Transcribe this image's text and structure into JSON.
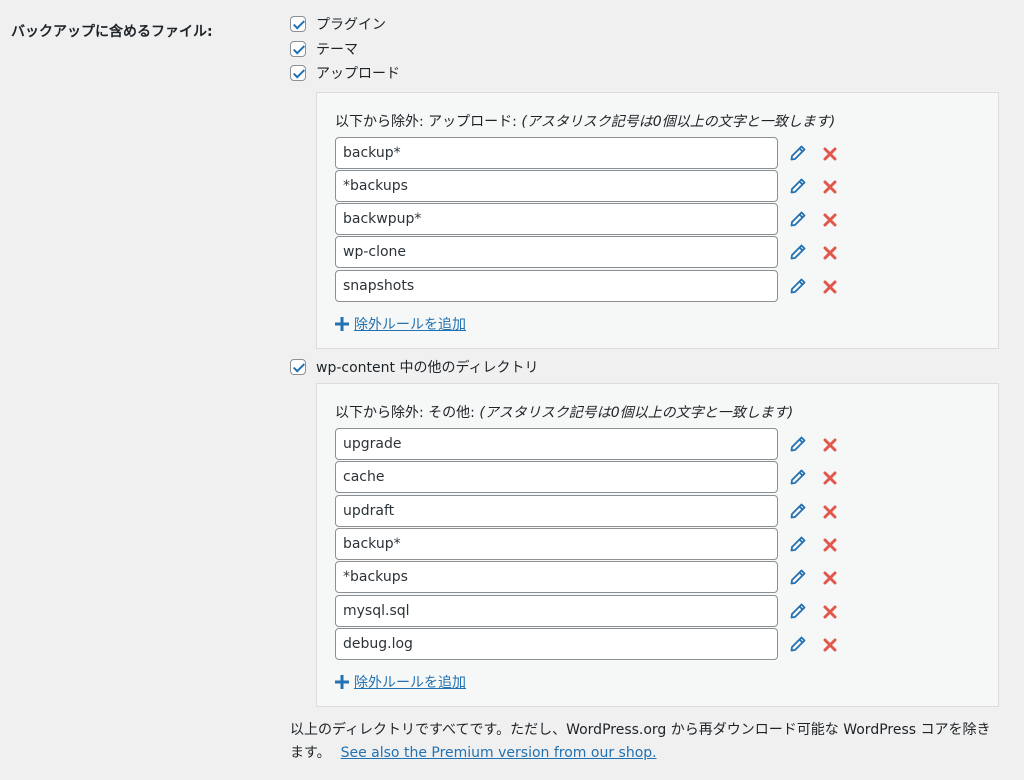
{
  "label": "バックアップに含めるファイル:",
  "checks": {
    "plugins": "プラグイン",
    "themes": "テーマ",
    "uploads": "アップロード",
    "others": "wp-content 中の他のディレクトリ"
  },
  "uploads_exclude": {
    "heading": "以下から除外: アップロード:",
    "hint": "(アスタリスク記号は0個以上の文字と一致します)",
    "rules": [
      "backup*",
      "*backups",
      "backwpup*",
      "wp-clone",
      "snapshots"
    ],
    "add_label": "除外ルールを追加"
  },
  "others_exclude": {
    "heading": "以下から除外: その他:",
    "hint": "(アスタリスク記号は0個以上の文字と一致します)",
    "rules": [
      "upgrade",
      "cache",
      "updraft",
      "backup*",
      "*backups",
      "mysql.sql",
      "debug.log"
    ],
    "add_label": "除外ルールを追加"
  },
  "footnote": {
    "text": "以上のディレクトリですべてです。ただし、WordPress.org から再ダウンロード可能な WordPress コアを除きます。",
    "link": "See also the Premium version from our shop."
  },
  "colors": {
    "link": "#2271b1",
    "delete": "#e2574c",
    "edit": "#2271b1"
  },
  "icons": {
    "edit": "pencil-icon",
    "delete": "close-icon",
    "add": "plus-icon",
    "checkbox": "checkmark-icon"
  }
}
